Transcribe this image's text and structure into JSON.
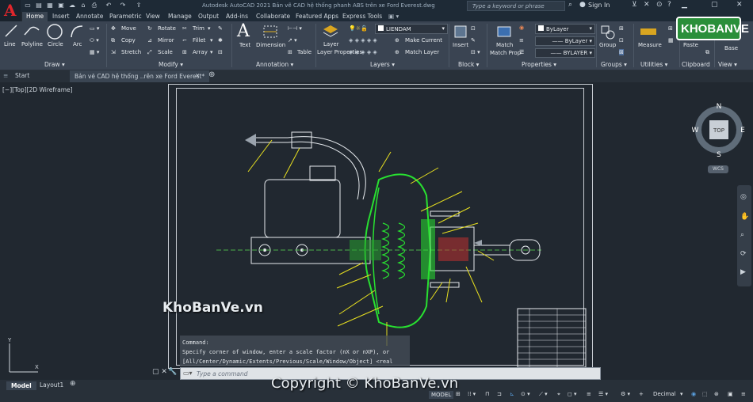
{
  "app": {
    "title": "Autodesk AutoCAD 2021    Bản vẽ CAD hệ thống phanh ABS trên xe Ford Everest.dwg",
    "logo_letter": "A",
    "search_placeholder": "Type a keyword or phrase",
    "sign_in": "Sign In"
  },
  "ribbon_tabs": [
    "Home",
    "Insert",
    "Annotate",
    "Parametric",
    "View",
    "Manage",
    "Output",
    "Add-ins",
    "Collaborate",
    "Featured Apps",
    "Express Tools"
  ],
  "ribbon": {
    "draw": {
      "line": "Line",
      "polyline": "Polyline",
      "circle": "Circle",
      "arc": "Arc",
      "panel": "Draw ▾"
    },
    "modify": {
      "move": "Move",
      "rotate": "Rotate",
      "trim": "Trim",
      "copy": "Copy",
      "mirror": "Mirror",
      "fillet": "Fillet",
      "stretch": "Stretch",
      "scale": "Scale",
      "array": "Array",
      "panel": "Modify ▾"
    },
    "annotation": {
      "text": "Text",
      "dimension": "Dimension",
      "table": "Table",
      "panel": "Annotation ▾"
    },
    "layers": {
      "layer_properties": "Layer Properties",
      "current_layer": "LIENDAM",
      "make_current": "Make Current",
      "match_layer": "Match Layer",
      "panel": "Layers ▾"
    },
    "block": {
      "insert": "Insert",
      "panel": "Block ▾"
    },
    "properties": {
      "match_properties": "Match Properties",
      "color": "ByLayer",
      "linetype": "ByLayer",
      "lineweight": "BYLAYER",
      "panel": "Properties ▾"
    },
    "groups": {
      "group": "Group",
      "panel": "Groups ▾"
    },
    "utilities": {
      "measure": "Measure",
      "panel": "Utilities ▾"
    },
    "clipboard": {
      "paste": "Paste",
      "panel": "Clipboard"
    },
    "view": {
      "base": "Base",
      "panel": "View ▾"
    }
  },
  "brand_logo": "KHOBANVE",
  "doc_tabs": {
    "start": "Start",
    "file": "Bản vẽ CAD hệ thống ..rên xe Ford Everest*"
  },
  "viewport_label": "[−][Top][2D Wireframe]",
  "viewcube": {
    "n": "N",
    "s": "S",
    "e": "E",
    "w": "W",
    "top": "TOP",
    "wcs": "WCS"
  },
  "command_history": [
    "Command:",
    "Specify corner of window, enter a scale factor (nX or nXP), or",
    "[All/Center/Dynamic/Extents/Previous/Scale/Window/Object] <real time>:"
  ],
  "command_placeholder": "Type a command",
  "watermark": "KhoBanVe.vn",
  "copyright": "Copyright © KhoBanVe.vn",
  "layout_tabs": [
    "Model",
    "Layout1"
  ],
  "status": {
    "model": "MODEL",
    "units": "Decimal"
  }
}
